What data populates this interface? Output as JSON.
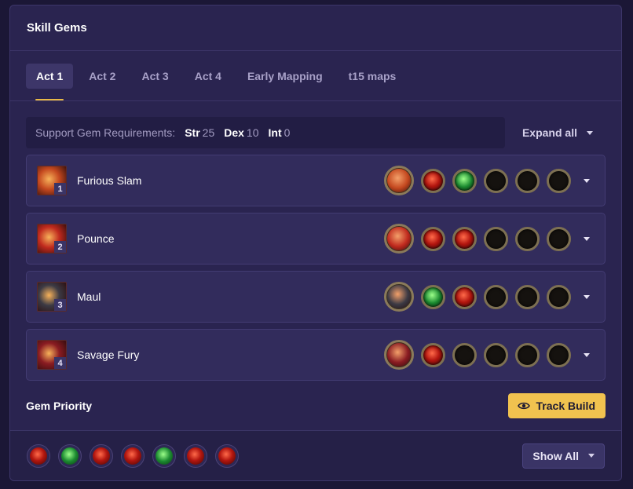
{
  "panel": {
    "title": "Skill Gems"
  },
  "tabs": [
    {
      "label": "Act 1",
      "active": true
    },
    {
      "label": "Act 2"
    },
    {
      "label": "Act 3"
    },
    {
      "label": "Act 4"
    },
    {
      "label": "Early Mapping"
    },
    {
      "label": "t15 maps"
    }
  ],
  "requirements": {
    "label": "Support Gem Requirements:",
    "str_label": "Str",
    "str_value": "25",
    "dex_label": "Dex",
    "dex_value": "10",
    "int_label": "Int",
    "int_value": "0"
  },
  "expand_all_label": "Expand all",
  "skills": [
    {
      "num": "1",
      "name": "Furious Slam",
      "main_color": "#c4481f",
      "sockets": [
        "red",
        "green",
        "empty",
        "empty",
        "empty"
      ]
    },
    {
      "num": "2",
      "name": "Pounce",
      "main_color": "#c02a1e",
      "sockets": [
        "red",
        "red",
        "empty",
        "empty",
        "empty"
      ]
    },
    {
      "num": "3",
      "name": "Maul",
      "main_color": "#3c3a44",
      "sockets": [
        "green",
        "red",
        "empty",
        "empty",
        "empty"
      ]
    },
    {
      "num": "4",
      "name": "Savage Fury",
      "main_color": "#8a1c22",
      "sockets": [
        "red",
        "empty",
        "empty",
        "empty",
        "empty"
      ]
    }
  ],
  "gem_priority": {
    "title": "Gem Priority",
    "track_build_label": "Track Build",
    "show_all_label": "Show All",
    "gems": [
      "red",
      "green",
      "red",
      "red",
      "green",
      "red",
      "red"
    ]
  },
  "colors": {
    "accent": "#f1c24f",
    "panel": "#2a2450",
    "row": "#322c5c"
  }
}
